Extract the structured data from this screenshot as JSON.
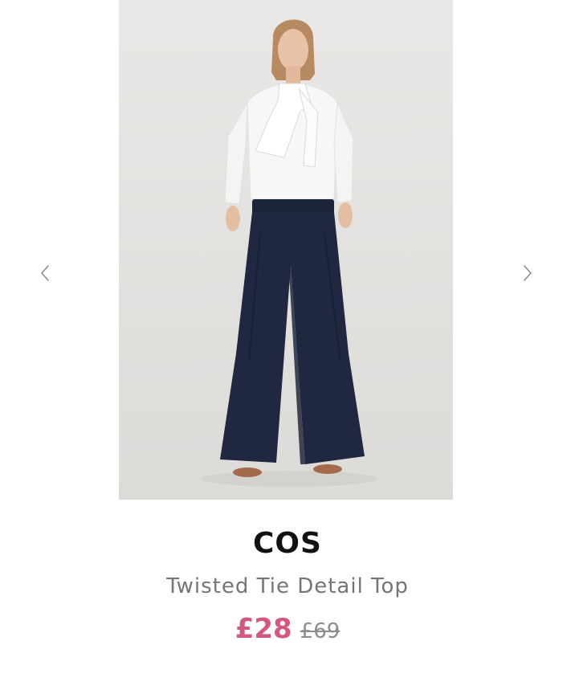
{
  "product": {
    "brand": "COS",
    "name": "Twisted Tie Detail Top",
    "sale_price": "£28",
    "original_price": "£69"
  },
  "gallery": {
    "prev_icon": "chevron-left-icon",
    "next_icon": "chevron-right-icon"
  },
  "colors": {
    "sale_price": "#d5577e",
    "image_background": "#e6e5e3",
    "brand_text": "#111111",
    "name_text": "#757575"
  }
}
